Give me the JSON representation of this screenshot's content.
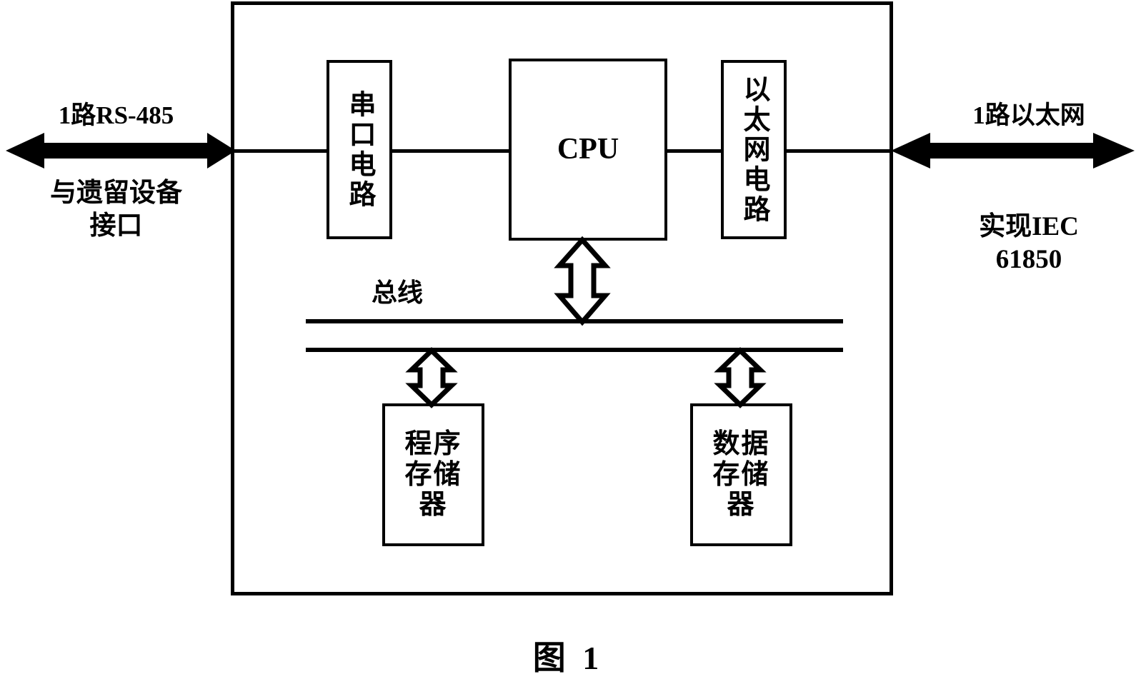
{
  "figure": {
    "caption": "图 1",
    "outer_box_name": "device-enclosure"
  },
  "left_annotation": {
    "top_label": "1路RS-485",
    "bottom_label": "与遗留设备\n接口",
    "arrow": "bidirectional-arrow"
  },
  "right_annotation": {
    "top_label": "1路以太网",
    "bottom_label": "实现IEC\n61850",
    "arrow": "bidirectional-arrow"
  },
  "blocks": {
    "serial_circuit": "串口电路",
    "cpu": "CPU",
    "ethernet_circuit": "以太网电路",
    "program_memory": "程序存储器",
    "data_memory": "数据存储器"
  },
  "bus": {
    "label": "总线"
  },
  "colors": {
    "line": "#000000",
    "background": "#ffffff"
  }
}
